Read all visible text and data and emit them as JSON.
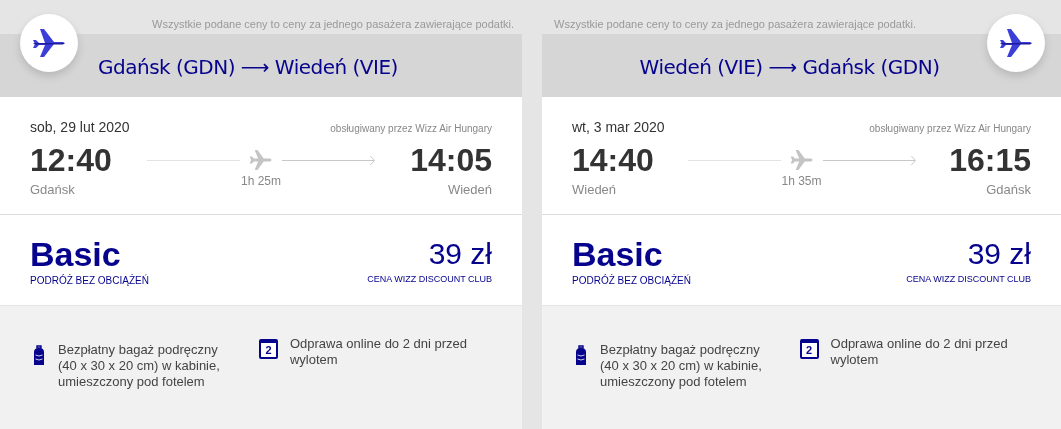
{
  "flights": [
    {
      "note": "Wszystkie podane ceny to ceny za jednego pasażera zawierające podatki.",
      "route_from": "Gdańsk (GDN)",
      "route_arrow": "⟶",
      "route_to": "Wiedeń (VIE)",
      "date": "sob, 29 lut 2020",
      "operator": "obsługiwany przez Wizz Air Hungary",
      "depart_time": "12:40",
      "depart_city": "Gdańsk",
      "duration": "1h 25m",
      "arrive_time": "14:05",
      "arrive_city": "Wiedeń",
      "fare": "Basic",
      "fare_subtitle": "PODRÓŻ BEZ OBCIĄŻEŃ",
      "price": "39 zł",
      "price_subtitle": "CENA WIZZ DISCOUNT CLUB",
      "features": [
        {
          "kind": "bag",
          "text": "Bezpłatny bagaż podręczny (40 x 30 x 20 cm) w kabinie, umieszczony pod fotelem"
        },
        {
          "kind": "calendar",
          "icon_text": "2",
          "text": "Odprawa online do 2 dni przed wylotem"
        }
      ]
    },
    {
      "note": "Wszystkie podane ceny to ceny za jednego pasażera zawierające podatki.",
      "route_from": "Wiedeń (VIE)",
      "route_arrow": "⟶",
      "route_to": "Gdańsk (GDN)",
      "date": "wt, 3 mar 2020",
      "operator": "obsługiwany przez Wizz Air Hungary",
      "depart_time": "14:40",
      "depart_city": "Wiedeń",
      "duration": "1h 35m",
      "arrive_time": "16:15",
      "arrive_city": "Gdańsk",
      "fare": "Basic",
      "fare_subtitle": "PODRÓŻ BEZ OBCIĄŻEŃ",
      "price": "39 zł",
      "price_subtitle": "CENA WIZZ DISCOUNT CLUB",
      "features": [
        {
          "kind": "bag",
          "text": "Bezpłatny bagaż podręczny (40 x 30 x 20 cm) w kabinie, umieszczony pod fotelem"
        },
        {
          "kind": "calendar",
          "icon_text": "2",
          "text": "Odprawa online do 2 dni przed wylotem"
        }
      ]
    }
  ]
}
